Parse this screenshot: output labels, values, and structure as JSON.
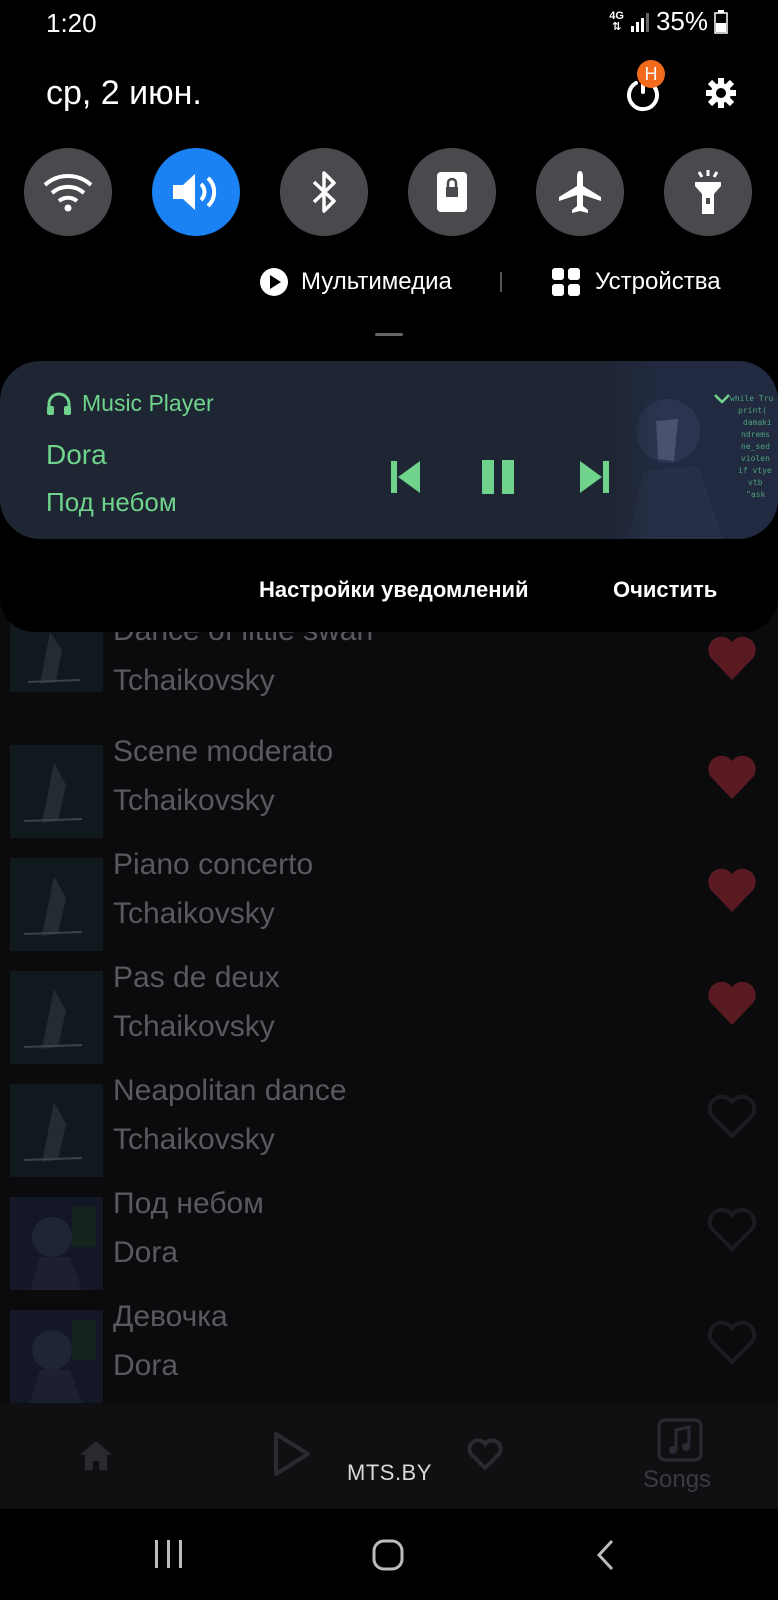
{
  "status_bar": {
    "time": "1:20",
    "network_top": "4G",
    "network_bottom": "⇅",
    "battery": "35%"
  },
  "shade": {
    "date": "ср, 2 июн.",
    "power_badge": "H",
    "quick_settings": [
      "wifi-icon",
      "sound-icon",
      "bluetooth-icon",
      "rotation-lock-icon",
      "airplane-icon",
      "flashlight-icon"
    ],
    "media_label": "Мультимедиа",
    "devices_label": "Устройства",
    "player": {
      "app_name": "Music Player",
      "artist": "Dora",
      "song": "Под небом"
    },
    "notification_settings": "Настройки уведомлений",
    "clear": "Очистить"
  },
  "songs": [
    {
      "title": "Dance of little swan",
      "artist": "Tchaikovsky",
      "liked": true
    },
    {
      "title": "Scene moderato",
      "artist": "Tchaikovsky",
      "liked": true
    },
    {
      "title": "Piano concerto",
      "artist": "Tchaikovsky",
      "liked": true
    },
    {
      "title": "Pas de deux",
      "artist": "Tchaikovsky",
      "liked": true
    },
    {
      "title": "Neapolitan dance",
      "artist": "Tchaikovsky",
      "liked": false
    },
    {
      "title": "Под небом",
      "artist": "Dora",
      "liked": false
    },
    {
      "title": "Девочка",
      "artist": "Dora",
      "liked": false
    }
  ],
  "bottom_nav": {
    "songs_label": "Songs",
    "carrier": "MTS.BY"
  },
  "colors": {
    "accent_green": "#6fd38b",
    "active_blue": "#1a82f5",
    "heart_red": "#5a1a22"
  }
}
